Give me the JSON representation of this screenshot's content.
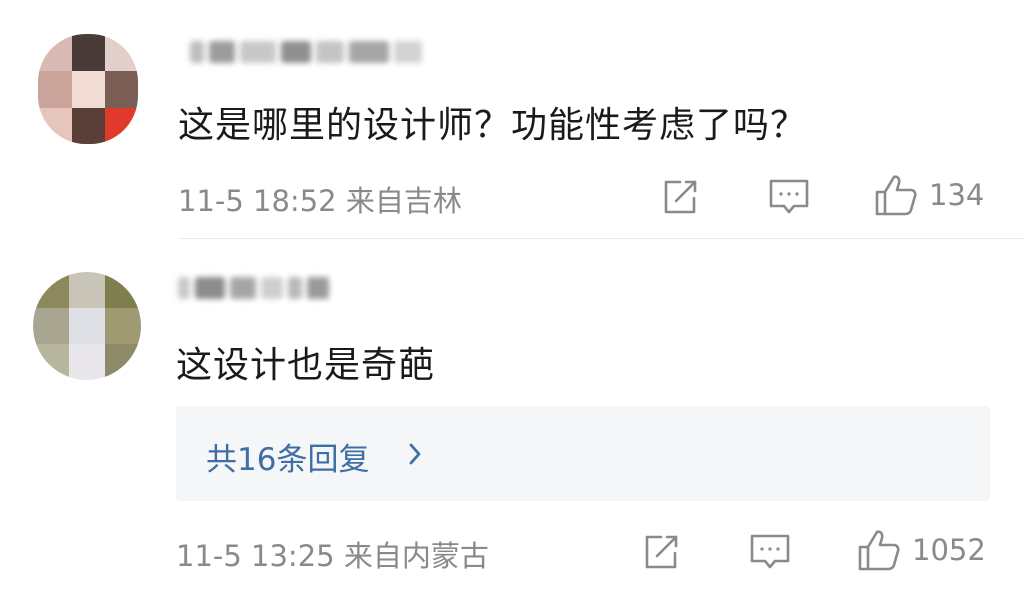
{
  "comments": [
    {
      "text": "这是哪里的设计师？功能性考虑了吗？",
      "meta": "11-5 18:52 来自吉林",
      "likes": "134"
    },
    {
      "text": "这设计也是奇葩",
      "meta": "11-5 13:25 来自内蒙古",
      "likes": "1052",
      "replies": "共16条回复"
    }
  ],
  "icons": {
    "share": "share-icon",
    "comment": "comment-icon",
    "like": "thumb-up-icon",
    "chevron": "chevron-right-icon"
  },
  "colors": {
    "text": "#1a1a1a",
    "meta": "#8a8a8a",
    "link": "#3f6ea3",
    "reply_bg": "#f5f6f8"
  }
}
